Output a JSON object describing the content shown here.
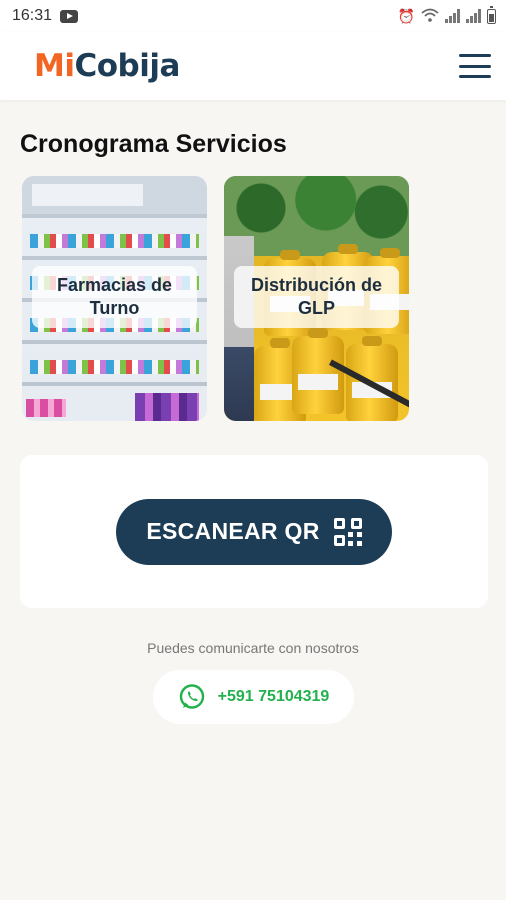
{
  "status_bar": {
    "time": "16:31"
  },
  "header": {
    "logo_part1": "Mi",
    "logo_part2": "Cobija"
  },
  "section": {
    "title": "Cronograma Servicios"
  },
  "cards": [
    {
      "label_line1": "Farmacias de",
      "label_line2": "Turno"
    },
    {
      "label_line1": "Distribución de",
      "label_line2": "GLP"
    }
  ],
  "qr": {
    "button_label": "ESCANEAR QR"
  },
  "contact": {
    "prompt": "Puedes comunicarte con nosotros",
    "phone": "+591 75104319"
  },
  "colors": {
    "brand_orange": "#f26522",
    "brand_navy": "#1d3d56",
    "whatsapp_green": "#22b14c"
  }
}
